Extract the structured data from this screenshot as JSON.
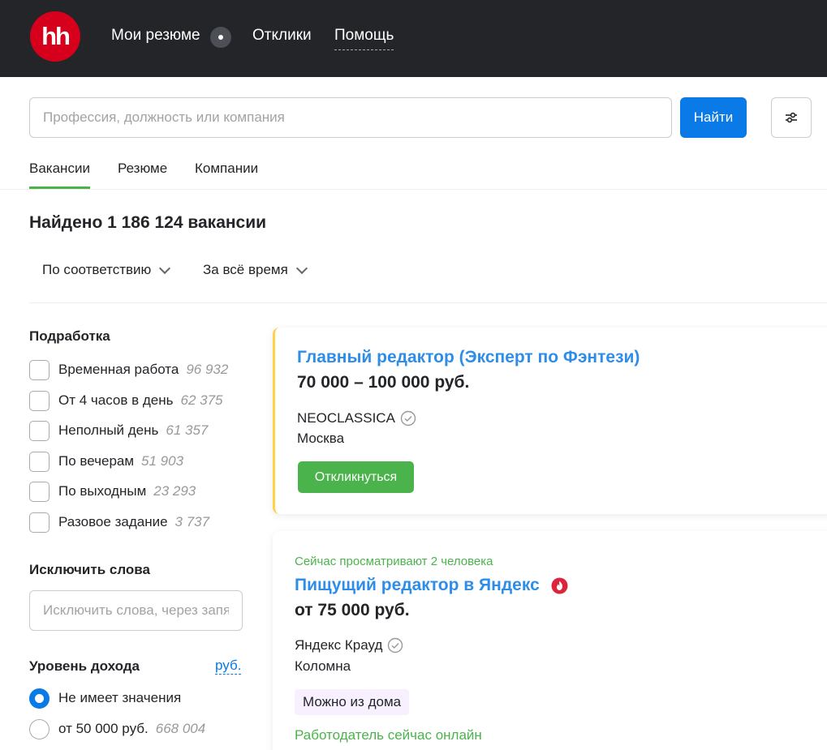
{
  "header": {
    "logo_text": "hh",
    "nav": [
      "Мои резюме",
      "Отклики",
      "Помощь"
    ]
  },
  "search": {
    "placeholder": "Профессия, должность или компания",
    "button_label": "Найти"
  },
  "tabs": [
    {
      "label": "Вакансии",
      "active": true
    },
    {
      "label": "Резюме",
      "active": false
    },
    {
      "label": "Компании",
      "active": false
    }
  ],
  "results": {
    "found_text": "Найдено 1 186 124 вакансии",
    "sort": [
      "По соответствию",
      "За всё время"
    ]
  },
  "filters": {
    "parttime_title": "Подработка",
    "parttime": [
      {
        "label": "Временная работа",
        "count": "96 932"
      },
      {
        "label": "От 4 часов в день",
        "count": "62 375"
      },
      {
        "label": "Неполный день",
        "count": "61 357"
      },
      {
        "label": "По вечерам",
        "count": "51 903"
      },
      {
        "label": "По выходным",
        "count": "23 293"
      },
      {
        "label": "Разовое задание",
        "count": "3 737"
      }
    ],
    "exclude_title": "Исключить слова",
    "exclude_placeholder": "Исключить слова, через запятую",
    "income_title": "Уровень дохода",
    "income_currency": "руб.",
    "income_options": [
      {
        "label": "Не имеет значения",
        "count": "",
        "selected": true
      },
      {
        "label": "от 50 000 руб.",
        "count": "668 004",
        "selected": false
      }
    ]
  },
  "vacancies": [
    {
      "title": "Главный редактор (Эксперт по Фэнтези)",
      "salary": "70 000 – 100 000 руб.",
      "company": "NEOCLASSICA",
      "city": "Москва",
      "apply_label": "Откликнуться"
    },
    {
      "viewing": "Сейчас просматривают 2 человека",
      "title": "Пищущий редактор в Яндекс",
      "salary": "от 75 000 руб.",
      "company": "Яндекс Крауд",
      "city": "Коломна",
      "tag": "Можно из дома",
      "online": "Работодатель сейчас онлайн"
    }
  ],
  "colors": {
    "header_bg": "#232529",
    "logo_red": "#d6001c",
    "primary_blue": "#0a7ae6",
    "green": "#4bb34b",
    "highlight_yellow": "#ffd24a"
  }
}
